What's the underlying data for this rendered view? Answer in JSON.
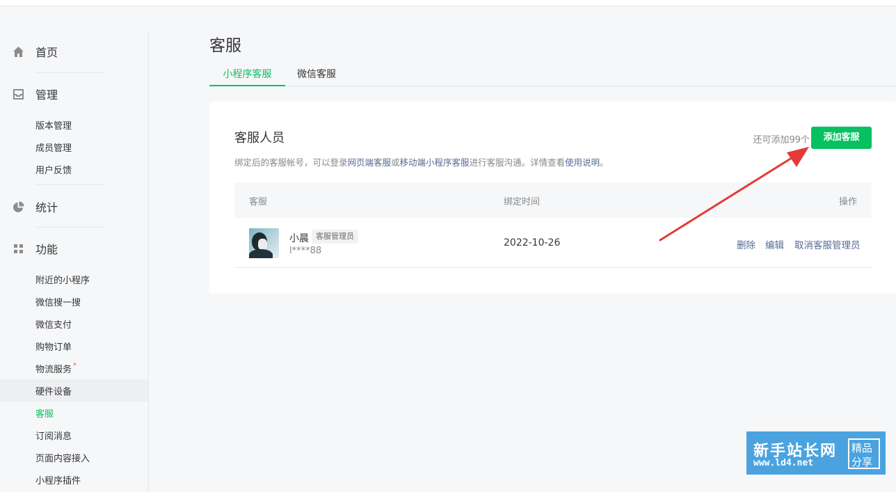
{
  "sidebar": {
    "groups": [
      {
        "label": "首页",
        "icon": "home-icon"
      },
      {
        "label": "管理",
        "icon": "inbox-icon"
      },
      {
        "label": "统计",
        "icon": "pie-chart-icon"
      },
      {
        "label": "功能",
        "icon": "grid-icon"
      }
    ],
    "manage_items": [
      "版本管理",
      "成员管理",
      "用户反馈"
    ],
    "feature_items": [
      "附近的小程序",
      "微信搜一搜",
      "微信支付",
      "购物订单",
      "物流服务",
      "硬件设备",
      "客服",
      "订阅消息",
      "页面内容接入",
      "小程序插件"
    ],
    "red_dot": "*"
  },
  "page": {
    "title": "客服",
    "tabs": [
      "小程序客服",
      "微信客服"
    ]
  },
  "card": {
    "title": "客服人员",
    "quota": "还可添加99个",
    "add_button": "添加客服",
    "desc": {
      "part1": "绑定后的客服帐号，可以登录",
      "link1": "网页端客服",
      "part2": "或",
      "link2": "移动端小程序客服",
      "part3": "进行客服沟通。详情查看",
      "link3": "使用说明",
      "part4": "。"
    }
  },
  "table": {
    "headers": [
      "客服",
      "绑定时间",
      "操作"
    ],
    "rows": [
      {
        "name": "小晨",
        "role": "客服管理员",
        "account": "l****88",
        "bind_time": "2022-10-26",
        "actions": [
          "删除",
          "编辑",
          "取消客服管理员"
        ]
      }
    ]
  },
  "watermark": {
    "line1": "新手站长网",
    "line2": "www.ld4.net",
    "box_top": "精品",
    "box_bottom": "分享"
  },
  "colors": {
    "accent": "#07c160",
    "link": "#576b95",
    "annotation_arrow": "#e53935"
  }
}
